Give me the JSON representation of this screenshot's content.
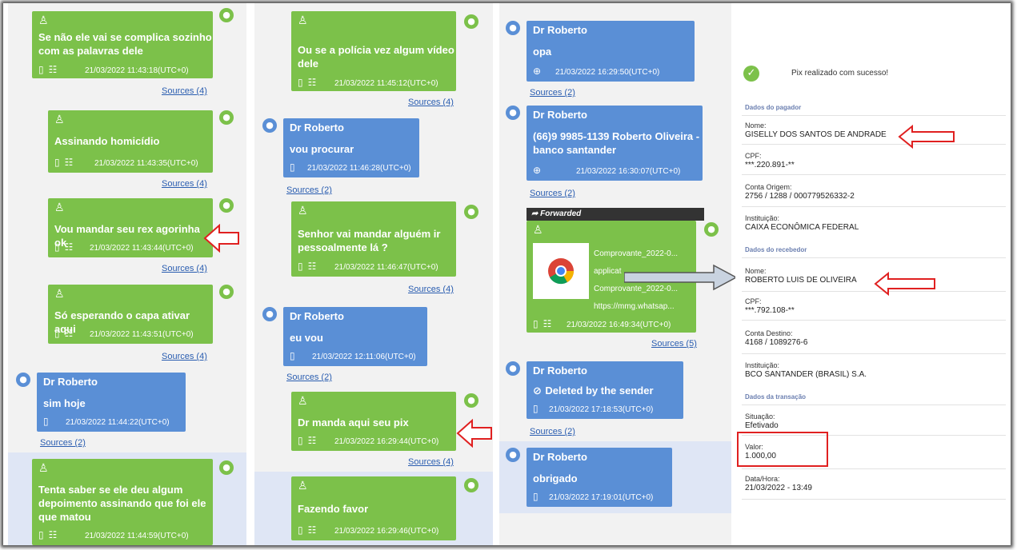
{
  "col1": {
    "b1": {
      "text1": "Se não ele vai se complica sozinho",
      "text2": "com as palavras dele",
      "ts": "21/03/2022 11:43:18(UTC+0)"
    },
    "s1": "Sources (4)",
    "b2": {
      "text": "Assinando homicídio",
      "ts": "21/03/2022 11:43:35(UTC+0)"
    },
    "s2": "Sources (4)",
    "b3": {
      "text": "Vou mandar seu rex agorinha ok",
      "ts": "21/03/2022 11:43:44(UTC+0)"
    },
    "s3": "Sources (4)",
    "b4": {
      "text": "Só esperando o capa ativar aqui",
      "ts": "21/03/2022 11:43:51(UTC+0)"
    },
    "s4": "Sources (4)",
    "b5": {
      "name": "Dr Roberto",
      "text": "sim hoje",
      "ts": "21/03/2022 11:44:22(UTC+0)"
    },
    "s5": "Sources (2)",
    "b6": {
      "text1": "Tenta saber se ele deu algum",
      "text2": "depoimento assinando que foi ele",
      "text3": "que matou",
      "ts": "21/03/2022 11:44:59(UTC+0)"
    }
  },
  "col2": {
    "b1": {
      "text1": "Ou se a polícia vez algum vídeo",
      "text2": "dele",
      "ts": "21/03/2022 11:45:12(UTC+0)"
    },
    "s1": "Sources (4)",
    "b2": {
      "name": "Dr Roberto",
      "text": "vou procurar",
      "ts": "21/03/2022 11:46:28(UTC+0)"
    },
    "s2": "Sources (2)",
    "b3": {
      "text1": "Senhor vai mandar alguém ir",
      "text2": "pessoalmente lá ?",
      "ts": "21/03/2022 11:46:47(UTC+0)"
    },
    "s3": "Sources (4)",
    "b4": {
      "name": "Dr Roberto",
      "text": "eu vou",
      "ts": "21/03/2022 12:11:06(UTC+0)"
    },
    "s4": "Sources (2)",
    "b5": {
      "text": "Dr manda aqui seu pix",
      "ts": "21/03/2022 16:29:44(UTC+0)"
    },
    "s5": "Sources (4)",
    "b6": {
      "text": "Fazendo favor",
      "ts": "21/03/2022 16:29:46(UTC+0)"
    }
  },
  "col3": {
    "b1": {
      "name": "Dr Roberto",
      "text": "opa",
      "ts": "21/03/2022 16:29:50(UTC+0)"
    },
    "s1": "Sources (2)",
    "b2": {
      "name": "Dr Roberto",
      "text1": "(66)9 9985-1139 Roberto Oliveira -",
      "text2": "banco santander",
      "ts": "21/03/2022 16:30:07(UTC+0)"
    },
    "s2": "Sources (2)",
    "fwd": "Forwarded",
    "b3": {
      "f1": "Comprovante_2022-0...",
      "f2": "applicat",
      "f3": "Comprovante_2022-0...",
      "f4": "https://mmg.whatsap...",
      "ts": "21/03/2022 16:49:34(UTC+0)"
    },
    "s3": "Sources (5)",
    "b4": {
      "name": "Dr Roberto",
      "text": "Deleted by the sender",
      "ts": "21/03/2022 17:18:53(UTC+0)"
    },
    "s4": "Sources (2)",
    "b5": {
      "name": "Dr Roberto",
      "text": "obrigado",
      "ts": "21/03/2022 17:19:01(UTC+0)"
    }
  },
  "receipt": {
    "status": "Pix realizado com sucesso!",
    "sec_payer": "Dados do pagador",
    "nome_lbl": "Nome:",
    "nome_val": "GISELLY DOS SANTOS DE ANDRADE",
    "cpf_lbl": "CPF:",
    "cpf_val": "***.220.891-**",
    "conta_orig_lbl": "Conta Origem:",
    "conta_orig_val": "2756 / 1288 / 000779526332-2",
    "inst_lbl": "Instituição:",
    "inst_val": "CAIXA ECONÔMICA FEDERAL",
    "sec_recv": "Dados do recebedor",
    "nome2_lbl": "Nome:",
    "nome2_val": "ROBERTO LUIS DE OLIVEIRA",
    "cpf2_lbl": "CPF:",
    "cpf2_val": "***.792.108-**",
    "conta_dest_lbl": "Conta Destino:",
    "conta_dest_val": "4168 / 1089276-6",
    "inst2_lbl": "Instituição:",
    "inst2_val": "BCO SANTANDER (BRASIL) S.A.",
    "sec_tx": "Dados da transação",
    "sit_lbl": "Situação:",
    "sit_val": "Efetivado",
    "valor_lbl": "Valor:",
    "valor_val": "1.000,00",
    "data_lbl": "Data/Hora:",
    "data_val": "21/03/2022 - 13:49"
  },
  "colors": {
    "green": "#7cc14a",
    "blue": "#5a8fd6",
    "arrow_red": "#e02020"
  }
}
